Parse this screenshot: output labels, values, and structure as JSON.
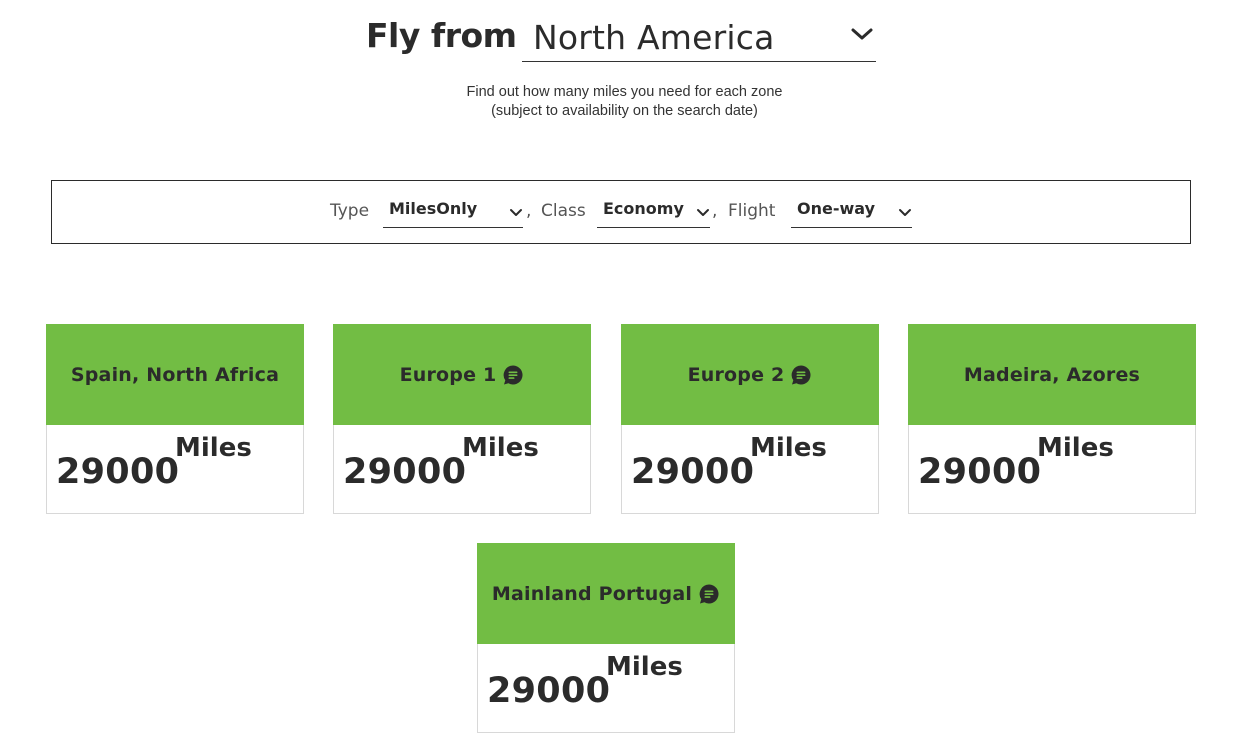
{
  "header": {
    "fly_from_label": "Fly from",
    "origin": "North America"
  },
  "subtitle": {
    "line1": "Find out how many miles you need for each zone",
    "line2": "(subject to availability on the search date)"
  },
  "filters": {
    "type_label": "Type",
    "type_value": "MilesOnly",
    "comma": ",",
    "class_label": "Class",
    "class_value": "Economy",
    "flight_label": "Flight",
    "flight_value": "One-way"
  },
  "zones": [
    {
      "name": "Spain, North Africa",
      "miles": "29000",
      "unit": "Miles",
      "has_info": false
    },
    {
      "name": "Europe 1",
      "miles": "29000",
      "unit": "Miles",
      "has_info": true
    },
    {
      "name": "Europe 2",
      "miles": "29000",
      "unit": "Miles",
      "has_info": true
    },
    {
      "name": "Madeira, Azores",
      "miles": "29000",
      "unit": "Miles",
      "has_info": false
    },
    {
      "name": "Mainland Portugal",
      "miles": "29000",
      "unit": "Miles",
      "has_info": true
    }
  ],
  "colors": {
    "accent_green": "#72bd44",
    "text": "#2b2b2b"
  },
  "icons": {
    "dropdown": "chevron-down-icon",
    "info": "info-chat-icon"
  }
}
